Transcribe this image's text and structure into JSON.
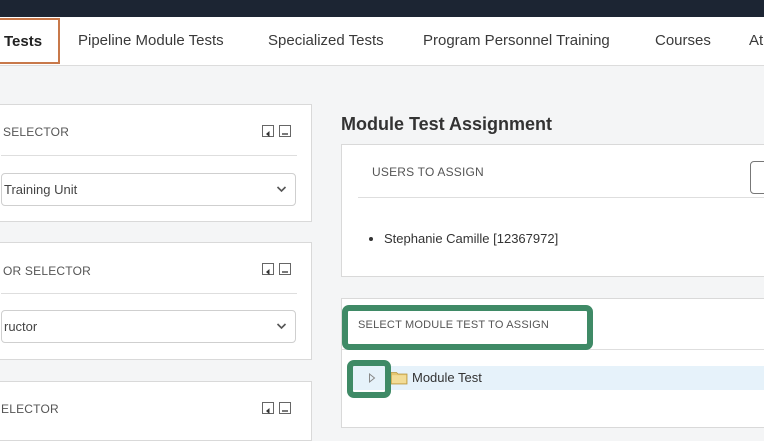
{
  "nav": {
    "tabs": [
      {
        "label": "Tests",
        "active": true
      },
      {
        "label": "Pipeline Module Tests"
      },
      {
        "label": "Specialized Tests"
      },
      {
        "label": "Program Personnel Training"
      },
      {
        "label": "Courses"
      },
      {
        "label": "At"
      }
    ]
  },
  "left": {
    "panel1": {
      "title": "SELECTOR",
      "select_value": "Training Unit"
    },
    "panel2": {
      "title": "OR SELECTOR",
      "select_value": "ructor"
    },
    "panel3": {
      "title": "ELECTOR"
    }
  },
  "main": {
    "heading": "Module Test Assignment",
    "users_title": "USERS TO ASSIGN",
    "users": [
      "Stephanie Camille [12367972]"
    ],
    "module_title": "SELECT MODULE TEST TO ASSIGN",
    "tree_node": "Module Test"
  },
  "colors": {
    "topbar": "#1c2533",
    "active_tab_border": "#c8784a",
    "highlight": "#3f8a66",
    "tree_row": "#e6f2fa"
  }
}
